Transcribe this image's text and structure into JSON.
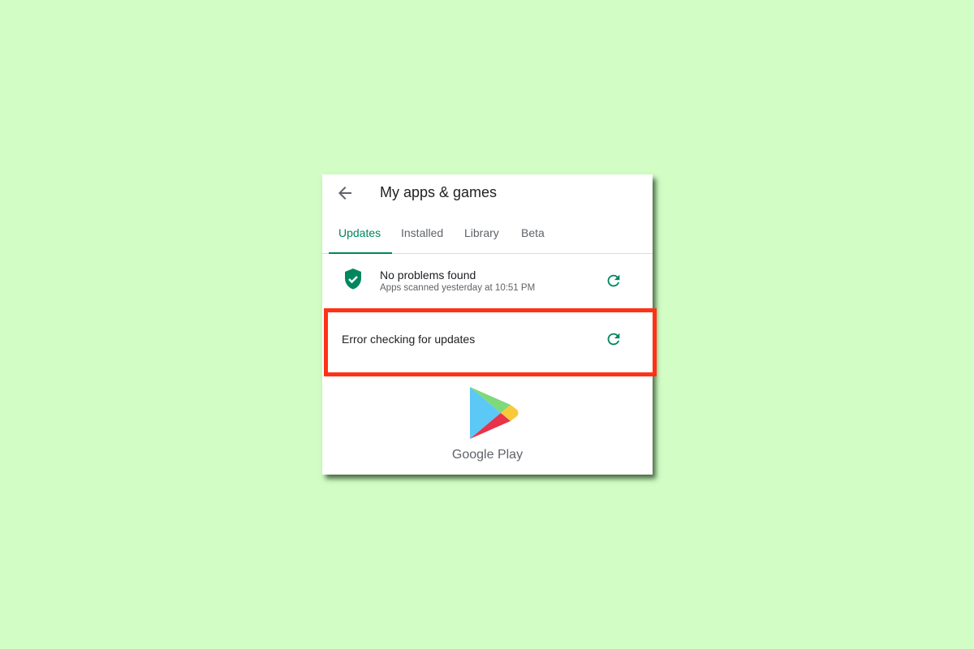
{
  "header": {
    "title": "My apps & games",
    "back_icon": "arrow-left-icon"
  },
  "tabs": [
    {
      "label": "Updates",
      "active": true
    },
    {
      "label": "Installed",
      "active": false
    },
    {
      "label": "Library",
      "active": false
    },
    {
      "label": "Beta",
      "active": false
    }
  ],
  "protect": {
    "title": "No problems found",
    "subtitle": "Apps scanned yesterday at 10:51 PM",
    "icon": "shield-check-icon"
  },
  "updates": {
    "message": "Error checking for updates"
  },
  "brand": {
    "name": "Google Play"
  },
  "colors": {
    "accent": "#01875f",
    "highlight": "#ff3217",
    "background": "#d2fdc4"
  }
}
